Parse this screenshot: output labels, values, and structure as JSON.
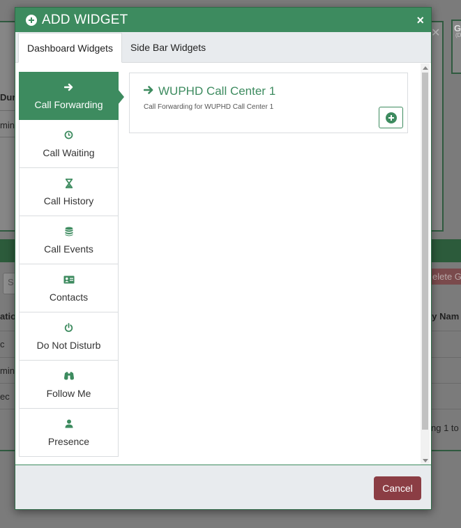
{
  "background": {
    "col_dura": "Dura",
    "row_ming": "ming",
    "search_placeholder": "S",
    "col_ation": "ation",
    "row_c": "c",
    "row_min": "min,",
    "row_ec": "ec",
    "delete_btn": "elete Gr",
    "col_day_name": "ay Nam",
    "paging": "ng 1 to",
    "right_header": "G",
    "right_sub": "(D"
  },
  "modal": {
    "title": "ADD WIDGET",
    "close": "×",
    "tabs": [
      {
        "label": "Dashboard Widgets",
        "active": true
      },
      {
        "label": "Side Bar Widgets",
        "active": false
      }
    ],
    "categories": [
      {
        "label": "Call Forwarding",
        "icon": "arrow-right-icon",
        "active": true
      },
      {
        "label": "Call Waiting",
        "icon": "clock-icon",
        "active": false
      },
      {
        "label": "Call History",
        "icon": "hourglass-icon",
        "active": false
      },
      {
        "label": "Call Events",
        "icon": "database-icon",
        "active": false
      },
      {
        "label": "Contacts",
        "icon": "id-card-icon",
        "active": false
      },
      {
        "label": "Do Not Disturb",
        "icon": "power-icon",
        "active": false
      },
      {
        "label": "Follow Me",
        "icon": "binoculars-icon",
        "active": false
      },
      {
        "label": "Presence",
        "icon": "user-icon",
        "active": false
      }
    ],
    "widget": {
      "title": "WUPHD Call Center 1",
      "description": "Call Forwarding for WUPHD Call Center 1"
    },
    "cancel": "Cancel"
  },
  "colors": {
    "primary": "#3d8b5f",
    "danger": "#8b3d44",
    "footer_bg": "#e8ebee"
  }
}
